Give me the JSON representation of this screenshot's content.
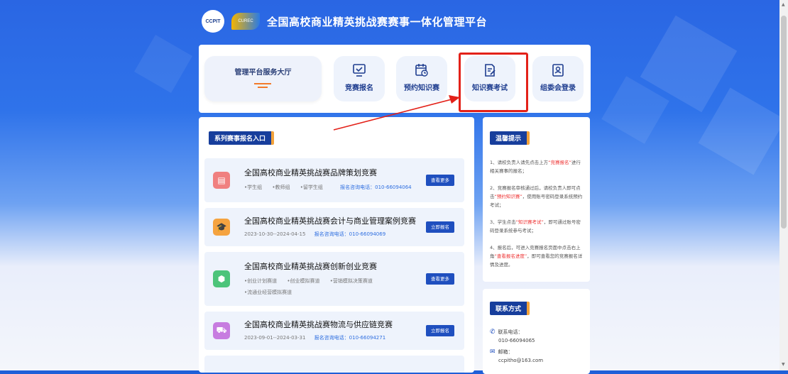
{
  "header": {
    "logo1_text": "CCPIT",
    "logo2_text": "CUREC",
    "title": "全国高校商业精英挑战赛赛事一体化管理平台"
  },
  "nav": {
    "service_hall": "管理平台服务大厅",
    "items": [
      {
        "label": "竞赛报名",
        "icon": "monitor-check-icon"
      },
      {
        "label": "预约知识赛",
        "icon": "calendar-clock-icon"
      },
      {
        "label": "知识赛考试",
        "icon": "edit-document-icon"
      },
      {
        "label": "组委会登录",
        "icon": "id-card-icon"
      }
    ]
  },
  "series_section": {
    "tag": "系列赛事报名入口",
    "competitions": [
      {
        "name": "全国高校商业精英挑战赛品牌策划竞赛",
        "tags": [
          "•学生组",
          "•教师组",
          "•留学生组"
        ],
        "phone": "报名咨询电话：010-66094064",
        "button": "查看更多",
        "icon_color": "#f08080"
      },
      {
        "name": "全国高校商业精英挑战赛会计与商业管理案例竞赛",
        "date": "2023-10-30--2024-04-15",
        "phone": "报名咨询电话：010-66094069",
        "button": "立即报名",
        "icon_color": "#f5a340"
      },
      {
        "name": "全国高校商业精英挑战赛创新创业竞赛",
        "tags": [
          "•创业计划赛道",
          "•创业模拟赛道",
          "•营销模拟决策赛道"
        ],
        "tags2": "•流通业经营模拟赛道",
        "button": "查看更多",
        "icon_color": "#4cc47a"
      },
      {
        "name": "全国高校商业精英挑战赛物流与供应链竞赛",
        "date": "2023-09-01--2024-03-31",
        "phone": "报名咨询电话：010-66094271",
        "button": "立即报名",
        "icon_color": "#c77ce0"
      }
    ]
  },
  "tips": {
    "tag": "温馨提示",
    "items": [
      {
        "a": "1、请校负责人请先点击上方",
        "red": "“竞赛报名”",
        "b": "进行相关赛事的报名；"
      },
      {
        "a": "2、竞赛报名审核通过后，请校负责人即可点击",
        "red": "“预约知识赛”",
        "b": "，使用账号密码登录系统预约考试；"
      },
      {
        "a": "3、学生点击",
        "red": "“知识赛考试”",
        "b": "，即可通过账号密码登录系统参与考试；"
      },
      {
        "a": "4、报名后，可进入竞赛报名页面中点击右上角",
        "red": "“查看报名进度”",
        "b": "，即可查看您的竞赛报名详情及进度。"
      }
    ]
  },
  "contact": {
    "tag": "联系方式",
    "phone_label": "联系电话：",
    "phone": "010-66094065",
    "email_label": "邮箱：",
    "email": "ccpitho@163.com"
  },
  "colors": {
    "primary": "#1f4fbf",
    "highlight_border": "#e32119",
    "accent": "#f27a2a"
  }
}
